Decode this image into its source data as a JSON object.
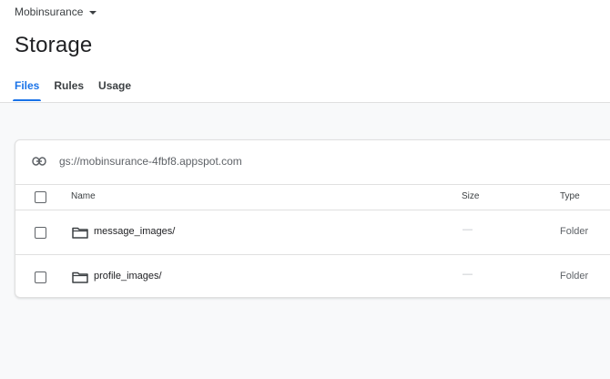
{
  "header": {
    "project_name": "Mobinsurance",
    "title": "Storage"
  },
  "tabs": [
    {
      "label": "Files",
      "active": true
    },
    {
      "label": "Rules",
      "active": false
    },
    {
      "label": "Usage",
      "active": false
    }
  ],
  "bucket": {
    "icon": "link-icon",
    "path": "gs://mobinsurance-4fbf8.appspot.com"
  },
  "table": {
    "columns": [
      "Name",
      "Size",
      "Type"
    ],
    "rows": [
      {
        "name": "message_images/",
        "size": "—",
        "type": "Folder",
        "icon": "folder-icon"
      },
      {
        "name": "profile_images/",
        "size": "—",
        "type": "Folder",
        "icon": "folder-icon"
      }
    ]
  },
  "colors": {
    "accent": "#1a73e8",
    "text": "#202124",
    "muted": "#5f6368",
    "background": "#f8f9fa",
    "border": "#e0e0e0"
  }
}
